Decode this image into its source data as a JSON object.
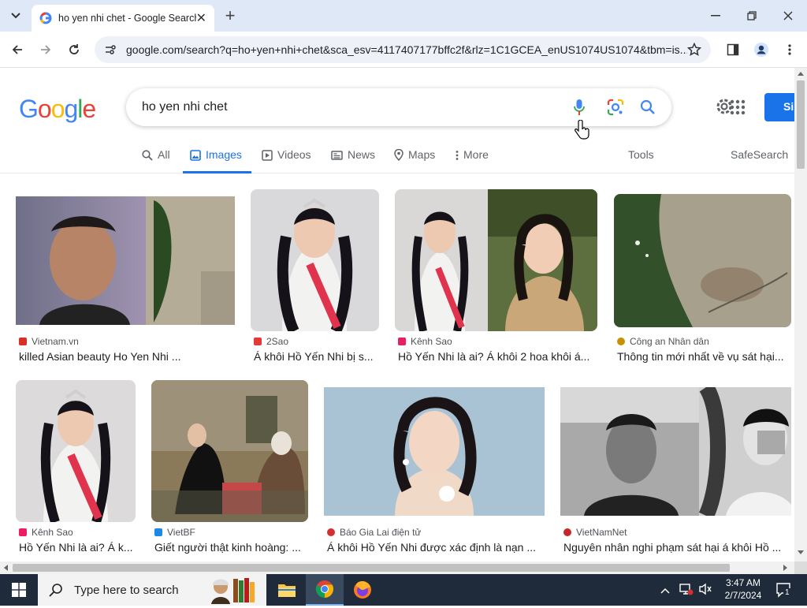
{
  "browser": {
    "tab_title": "ho yen nhi chet - Google Search",
    "url": "google.com/search?q=ho+yen+nhi+chet&sca_esv=4117407177bffc2f&rlz=1C1GCEA_enUS1074US1074&tbm=is..."
  },
  "google": {
    "logo": "Google",
    "query": "ho yen nhi chet",
    "signin_label": "Si",
    "tabs": [
      {
        "label": "All"
      },
      {
        "label": "Images"
      },
      {
        "label": "Videos"
      },
      {
        "label": "News"
      },
      {
        "label": "Maps"
      },
      {
        "label": "More"
      }
    ],
    "tools_label": "Tools",
    "safesearch_label": "SafeSearch"
  },
  "results": [
    {
      "source": "Vietnam.vn",
      "title": "killed Asian beauty Ho Yen Nhi ...",
      "fav_color": "#d93025"
    },
    {
      "source": "2Sao",
      "title": "Á khôi Hồ Yến Nhi bị s...",
      "fav_color": "#e53935"
    },
    {
      "source": "Kênh Sao",
      "title": "Hồ Yến Nhi là ai? Á khôi 2 hoa khôi á...",
      "fav_color": "#e91e63"
    },
    {
      "source": "Công an Nhân dân",
      "title": "Thông tin mới nhất về vụ sát hại...",
      "fav_color": "#c79200"
    },
    {
      "source": "Kênh Sao",
      "title": "Hồ Yến Nhi là ai? Á k...",
      "fav_color": "#e91e63"
    },
    {
      "source": "VietBF",
      "title": "Giết người thật kinh hoàng: ...",
      "fav_color": "#1e88e5"
    },
    {
      "source": "Báo Gia Lai điện tử",
      "title": "Á khôi Hồ Yến Nhi được xác định là nạn ...",
      "fav_color": "#d32f2f"
    },
    {
      "source": "VietNamNet",
      "title": "Nguyên nhân nghi phạm sát hại á khôi Hồ ...",
      "fav_color": "#c62828"
    }
  ],
  "taskbar": {
    "search_placeholder": "Type here to search",
    "time": "3:47 AM",
    "date": "2/7/2024",
    "notification_count": "1"
  }
}
